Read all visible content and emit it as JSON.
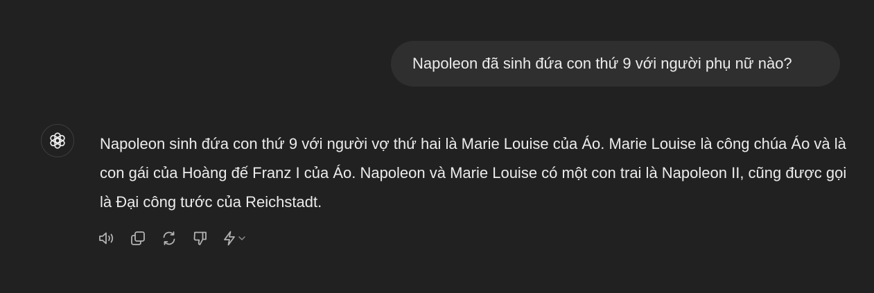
{
  "conversation": {
    "user_message": "Napoleon đã sinh đứa con thứ 9 với người phụ nữ nào?",
    "assistant_message": "Napoleon sinh đứa con thứ 9 với người vợ thứ hai là Marie Louise của Áo. Marie Louise là công chúa Áo và là con gái của Hoàng đế Franz I của Áo. Napoleon và Marie Louise có một con trai là Napoleon II, cũng được gọi là Đại công tước của Reichstadt."
  },
  "icons": {
    "avatar": "openai-logo-icon",
    "read_aloud": "speaker-icon",
    "copy": "copy-icon",
    "regenerate": "regenerate-icon",
    "dislike": "thumbs-down-icon",
    "model_switch": "lightning-icon",
    "model_switch_caret": "chevron-down-icon"
  },
  "colors": {
    "background": "#212121",
    "user_bubble": "#2f2f2f",
    "text": "#ececec",
    "icon": "#b4b4b4"
  }
}
